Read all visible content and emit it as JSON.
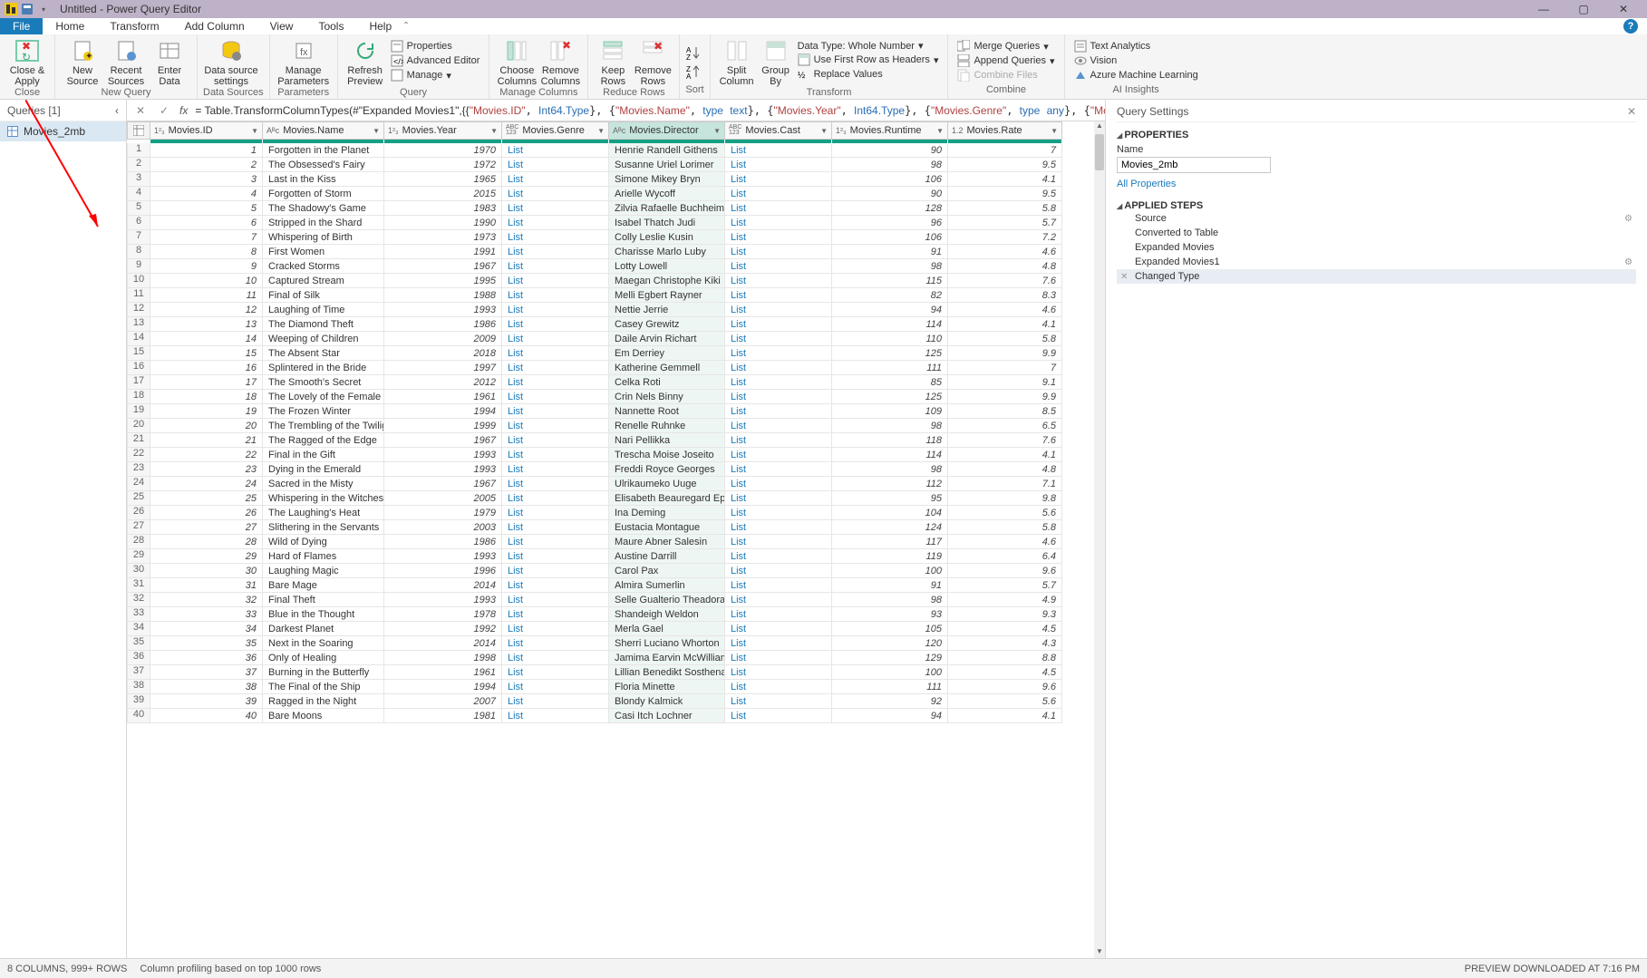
{
  "window": {
    "title": "Untitled - Power Query Editor"
  },
  "menutabs": {
    "file": "File",
    "home": "Home",
    "transform": "Transform",
    "addcol": "Add Column",
    "view": "View",
    "tools": "Tools",
    "help": "Help"
  },
  "ribbon": {
    "close_apply": "Close &\nApply",
    "close_group": "Close",
    "new_source": "New\nSource",
    "recent_sources": "Recent\nSources",
    "enter_data": "Enter\nData",
    "new_query_group": "New Query",
    "ds_settings": "Data source\nsettings",
    "ds_group": "Data Sources",
    "manage_params": "Manage\nParameters",
    "params_group": "Parameters",
    "refresh": "Refresh\nPreview",
    "properties": "Properties",
    "adv_editor": "Advanced Editor",
    "manage": "Manage",
    "query_group": "Query",
    "choose_cols": "Choose\nColumns",
    "remove_cols": "Remove\nColumns",
    "manage_cols_group": "Manage Columns",
    "keep_rows": "Keep\nRows",
    "remove_rows": "Remove\nRows",
    "reduce_group": "Reduce Rows",
    "sort_group": "Sort",
    "split_col": "Split\nColumn",
    "group_by": "Group\nBy",
    "data_type": "Data Type: Whole Number",
    "first_row": "Use First Row as Headers",
    "replace": "Replace Values",
    "transform_group": "Transform",
    "merge": "Merge Queries",
    "append": "Append Queries",
    "combine_files": "Combine Files",
    "combine_group": "Combine",
    "text_an": "Text Analytics",
    "vision": "Vision",
    "aml": "Azure Machine Learning",
    "ai_group": "AI Insights"
  },
  "queries": {
    "header": "Queries [1]",
    "item": "Movies_2mb"
  },
  "formula": {
    "prefix": "= Table.TransformColumnTypes(#\"Expanded Movies1\",{{",
    "c1": "\"Movies.ID\"",
    "t1": "Int64.Type",
    "c2": "\"Movies.Name\"",
    "t2k": "type",
    "t2v": "text",
    "c3": "\"Movies.Year\"",
    "t3": "Int64.Type",
    "c4": "\"Movies.Genre\"",
    "t4k": "type",
    "t4v": "any",
    "c5": "\"Movies.Director\""
  },
  "columns": {
    "id": "Movies.ID",
    "name": "Movies.Name",
    "year": "Movies.Year",
    "genre": "Movies.Genre",
    "director": "Movies.Director",
    "cast": "Movies.Cast",
    "runtime": "Movies.Runtime",
    "rate": "Movies.Rate",
    "t_int": "1²₃",
    "t_abc": "Aᴮc",
    "t_abc123": "ABC\n123",
    "t_dec": "1.2"
  },
  "rows": [
    {
      "n": 1,
      "id": 1,
      "name": "Forgotten in the Planet",
      "year": 1970,
      "dir": "Henrie Randell Githens",
      "run": 90,
      "rate": "7"
    },
    {
      "n": 2,
      "id": 2,
      "name": "The Obsessed's Fairy",
      "year": 1972,
      "dir": "Susanne Uriel Lorimer",
      "run": 98,
      "rate": "9.5"
    },
    {
      "n": 3,
      "id": 3,
      "name": "Last in the Kiss",
      "year": 1965,
      "dir": "Simone Mikey Bryn",
      "run": 106,
      "rate": "4.1"
    },
    {
      "n": 4,
      "id": 4,
      "name": "Forgotten of Storm",
      "year": 2015,
      "dir": "Arielle Wycoff",
      "run": 90,
      "rate": "9.5"
    },
    {
      "n": 5,
      "id": 5,
      "name": "The Shadowy's Game",
      "year": 1983,
      "dir": "Zilvia Rafaelle Buchheim",
      "run": 128,
      "rate": "5.8"
    },
    {
      "n": 6,
      "id": 6,
      "name": "Stripped in the Shard",
      "year": 1990,
      "dir": "Isabel Thatch Judi",
      "run": 96,
      "rate": "5.7"
    },
    {
      "n": 7,
      "id": 7,
      "name": "Whispering of Birth",
      "year": 1973,
      "dir": "Colly Leslie Kusin",
      "run": 106,
      "rate": "7.2"
    },
    {
      "n": 8,
      "id": 8,
      "name": "First Women",
      "year": 1991,
      "dir": "Charisse Marlo Luby",
      "run": 91,
      "rate": "4.6"
    },
    {
      "n": 9,
      "id": 9,
      "name": "Cracked Storms",
      "year": 1967,
      "dir": "Lotty Lowell",
      "run": 98,
      "rate": "4.8"
    },
    {
      "n": 10,
      "id": 10,
      "name": "Captured Stream",
      "year": 1995,
      "dir": "Maegan Christophe Kiki",
      "run": 115,
      "rate": "7.6"
    },
    {
      "n": 11,
      "id": 11,
      "name": "Final of Silk",
      "year": 1988,
      "dir": "Melli Egbert Rayner",
      "run": 82,
      "rate": "8.3"
    },
    {
      "n": 12,
      "id": 12,
      "name": "Laughing of Time",
      "year": 1993,
      "dir": "Nettie Jerrie",
      "run": 94,
      "rate": "4.6"
    },
    {
      "n": 13,
      "id": 13,
      "name": "The Diamond Theft",
      "year": 1986,
      "dir": "Casey Grewitz",
      "run": 114,
      "rate": "4.1"
    },
    {
      "n": 14,
      "id": 14,
      "name": "Weeping of Children",
      "year": 2009,
      "dir": "Daile Arvin Richart",
      "run": 110,
      "rate": "5.8"
    },
    {
      "n": 15,
      "id": 15,
      "name": "The Absent Star",
      "year": 2018,
      "dir": "Em Derriey",
      "run": 125,
      "rate": "9.9"
    },
    {
      "n": 16,
      "id": 16,
      "name": "Splintered in the Bride",
      "year": 1997,
      "dir": "Katherine Gemmell",
      "run": 111,
      "rate": "7"
    },
    {
      "n": 17,
      "id": 17,
      "name": "The Smooth's Secret",
      "year": 2012,
      "dir": "Celka Roti",
      "run": 85,
      "rate": "9.1"
    },
    {
      "n": 18,
      "id": 18,
      "name": "The Lovely of the Female",
      "year": 1961,
      "dir": "Crin Nels Binny",
      "run": 125,
      "rate": "9.9"
    },
    {
      "n": 19,
      "id": 19,
      "name": "The Frozen Winter",
      "year": 1994,
      "dir": "Nannette Root",
      "run": 109,
      "rate": "8.5"
    },
    {
      "n": 20,
      "id": 20,
      "name": "The Trembling of the Twilight",
      "year": 1999,
      "dir": "Renelle Ruhnke",
      "run": 98,
      "rate": "6.5"
    },
    {
      "n": 21,
      "id": 21,
      "name": "The Ragged of the Edge",
      "year": 1967,
      "dir": "Nari Pellikka",
      "run": 118,
      "rate": "7.6"
    },
    {
      "n": 22,
      "id": 22,
      "name": "Final in the Gift",
      "year": 1993,
      "dir": "Trescha Moise Joseito",
      "run": 114,
      "rate": "4.1"
    },
    {
      "n": 23,
      "id": 23,
      "name": "Dying in the Emerald",
      "year": 1993,
      "dir": "Freddi Royce Georges",
      "run": 98,
      "rate": "4.8"
    },
    {
      "n": 24,
      "id": 24,
      "name": "Sacred in the Misty",
      "year": 1967,
      "dir": "Ulrikaumeko Uuge",
      "run": 112,
      "rate": "7.1"
    },
    {
      "n": 25,
      "id": 25,
      "name": "Whispering in the Witches",
      "year": 2005,
      "dir": "Elisabeth Beauregard Eph",
      "run": 95,
      "rate": "9.8"
    },
    {
      "n": 26,
      "id": 26,
      "name": "The Laughing's Heat",
      "year": 1979,
      "dir": "Ina Deming",
      "run": 104,
      "rate": "5.6"
    },
    {
      "n": 27,
      "id": 27,
      "name": "Slithering in the Servants",
      "year": 2003,
      "dir": "Eustacia Montague",
      "run": 124,
      "rate": "5.8"
    },
    {
      "n": 28,
      "id": 28,
      "name": "Wild of Dying",
      "year": 1986,
      "dir": "Maure Abner Salesin",
      "run": 117,
      "rate": "4.6"
    },
    {
      "n": 29,
      "id": 29,
      "name": "Hard of Flames",
      "year": 1993,
      "dir": "Austine Darrill",
      "run": 119,
      "rate": "6.4"
    },
    {
      "n": 30,
      "id": 30,
      "name": "Laughing Magic",
      "year": 1996,
      "dir": "Carol Pax",
      "run": 100,
      "rate": "9.6"
    },
    {
      "n": 31,
      "id": 31,
      "name": "Bare Mage",
      "year": 2014,
      "dir": "Almira Sumerlin",
      "run": 91,
      "rate": "5.7"
    },
    {
      "n": 32,
      "id": 32,
      "name": "Final Theft",
      "year": 1993,
      "dir": "Selle Gualterio Theadora",
      "run": 98,
      "rate": "4.9"
    },
    {
      "n": 33,
      "id": 33,
      "name": "Blue in the Thought",
      "year": 1978,
      "dir": "Shandeigh Weldon",
      "run": 93,
      "rate": "9.3"
    },
    {
      "n": 34,
      "id": 34,
      "name": "Darkest Planet",
      "year": 1992,
      "dir": "Merla Gael",
      "run": 105,
      "rate": "4.5"
    },
    {
      "n": 35,
      "id": 35,
      "name": "Next in the Soaring",
      "year": 2014,
      "dir": "Sherri Luciano Whorton",
      "run": 120,
      "rate": "4.3"
    },
    {
      "n": 36,
      "id": 36,
      "name": "Only of Healing",
      "year": 1998,
      "dir": "Jamima Earvin McWilliams",
      "run": 129,
      "rate": "8.8"
    },
    {
      "n": 37,
      "id": 37,
      "name": "Burning in the Butterfly",
      "year": 1961,
      "dir": "Lillian Benedikt Sosthena",
      "run": 100,
      "rate": "4.5"
    },
    {
      "n": 38,
      "id": 38,
      "name": "The Final of the Ship",
      "year": 1994,
      "dir": "Floria Minette",
      "run": 111,
      "rate": "9.6"
    },
    {
      "n": 39,
      "id": 39,
      "name": "Ragged in the Night",
      "year": 2007,
      "dir": "Blondy Kalmick",
      "run": 92,
      "rate": "5.6"
    },
    {
      "n": 40,
      "id": 40,
      "name": "Bare Moons",
      "year": 1981,
      "dir": "Casi Itch Lochner",
      "run": 94,
      "rate": "4.1"
    }
  ],
  "list_text": "List",
  "settings": {
    "title": "Query Settings",
    "properties": "PROPERTIES",
    "name_label": "Name",
    "name_value": "Movies_2mb",
    "all_props": "All Properties",
    "applied": "APPLIED STEPS",
    "steps": [
      "Source",
      "Converted to Table",
      "Expanded Movies",
      "Expanded Movies1",
      "Changed Type"
    ]
  },
  "status": {
    "left": "8 COLUMNS, 999+ ROWS",
    "mid": "Column profiling based on top 1000 rows",
    "right": "PREVIEW DOWNLOADED AT 7:16 PM"
  }
}
